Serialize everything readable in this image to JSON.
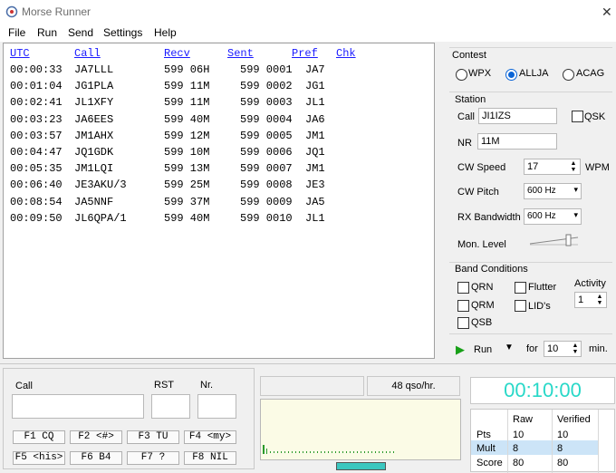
{
  "window": {
    "title": "Morse Runner",
    "close_glyph": "✕"
  },
  "menu": [
    "File",
    "Run",
    "Send",
    "Settings",
    "Help"
  ],
  "log": {
    "headers": [
      "UTC",
      "Call",
      "Recv",
      "Sent",
      "Pref",
      "Chk"
    ],
    "rows": [
      [
        "00:00:33",
        "JA7LLL",
        "599 06H",
        "599 0001",
        "JA7"
      ],
      [
        "00:01:04",
        "JG1PLA",
        "599 11M",
        "599 0002",
        "JG1"
      ],
      [
        "00:02:41",
        "JL1XFY",
        "599 11M",
        "599 0003",
        "JL1"
      ],
      [
        "00:03:23",
        "JA6EES",
        "599 40M",
        "599 0004",
        "JA6"
      ],
      [
        "00:03:57",
        "JM1AHX",
        "599 12M",
        "599 0005",
        "JM1"
      ],
      [
        "00:04:47",
        "JQ1GDK",
        "599 10M",
        "599 0006",
        "JQ1"
      ],
      [
        "00:05:35",
        "JM1LQI",
        "599 13M",
        "599 0007",
        "JM1"
      ],
      [
        "00:06:40",
        "JE3AKU/3",
        "599 25M",
        "599 0008",
        "JE3"
      ],
      [
        "00:08:54",
        "JA5NNF",
        "599 37M",
        "599 0009",
        "JA5"
      ],
      [
        "00:09:50",
        "JL6QPA/1",
        "599 40M",
        "599 0010",
        "JL1"
      ]
    ]
  },
  "contest": {
    "title": "Contest",
    "options": [
      "WPX",
      "ALLJA",
      "ACAG"
    ],
    "selected": "ALLJA"
  },
  "station": {
    "title": "Station",
    "call_label": "Call",
    "call_value": "JI1IZS",
    "qsk_label": "QSK",
    "nr_label": "NR",
    "nr_value": "11M",
    "cw_speed_label": "CW Speed",
    "cw_speed_value": "17",
    "wpm_label": "WPM",
    "cw_pitch_label": "CW Pitch",
    "cw_pitch_value": "600 Hz",
    "rx_bw_label": "RX Bandwidth",
    "rx_bw_value": "600 Hz",
    "mon_level_label": "Mon. Level"
  },
  "band": {
    "title": "Band Conditions",
    "qrn": "QRN",
    "qrm": "QRM",
    "qsb": "QSB",
    "flutter": "Flutter",
    "lids": "LID's",
    "activity_label": "Activity",
    "activity_value": "1"
  },
  "run": {
    "label": "Run",
    "for_label": "for",
    "minutes": "10",
    "min_label": "min."
  },
  "entry": {
    "call_label": "Call",
    "rst_label": "RST",
    "nr_label": "Nr.",
    "fkeys": [
      "F1 CQ",
      "F2 <#>",
      "F3 TU",
      "F4 <my>",
      "F5 <his>",
      "F6 B4",
      "F7 ?",
      "F8 NIL"
    ]
  },
  "rate": {
    "text": "48 qso/hr."
  },
  "clock": {
    "time": "00:10:00"
  },
  "score": {
    "headers": [
      "",
      "Raw",
      "Verified"
    ],
    "rows": [
      [
        "Pts",
        "10",
        "10"
      ],
      [
        "Mult",
        "8",
        "8"
      ],
      [
        "Score",
        "80",
        "80"
      ]
    ]
  },
  "colors": {
    "accent": "#0a64d6",
    "log_header": "#1a1aff",
    "clock": "#28d8c8",
    "band_scope_bg": "#fbfbe6",
    "tuning_bar": "#3cc7c0",
    "selected_row": "#cce4f7"
  }
}
